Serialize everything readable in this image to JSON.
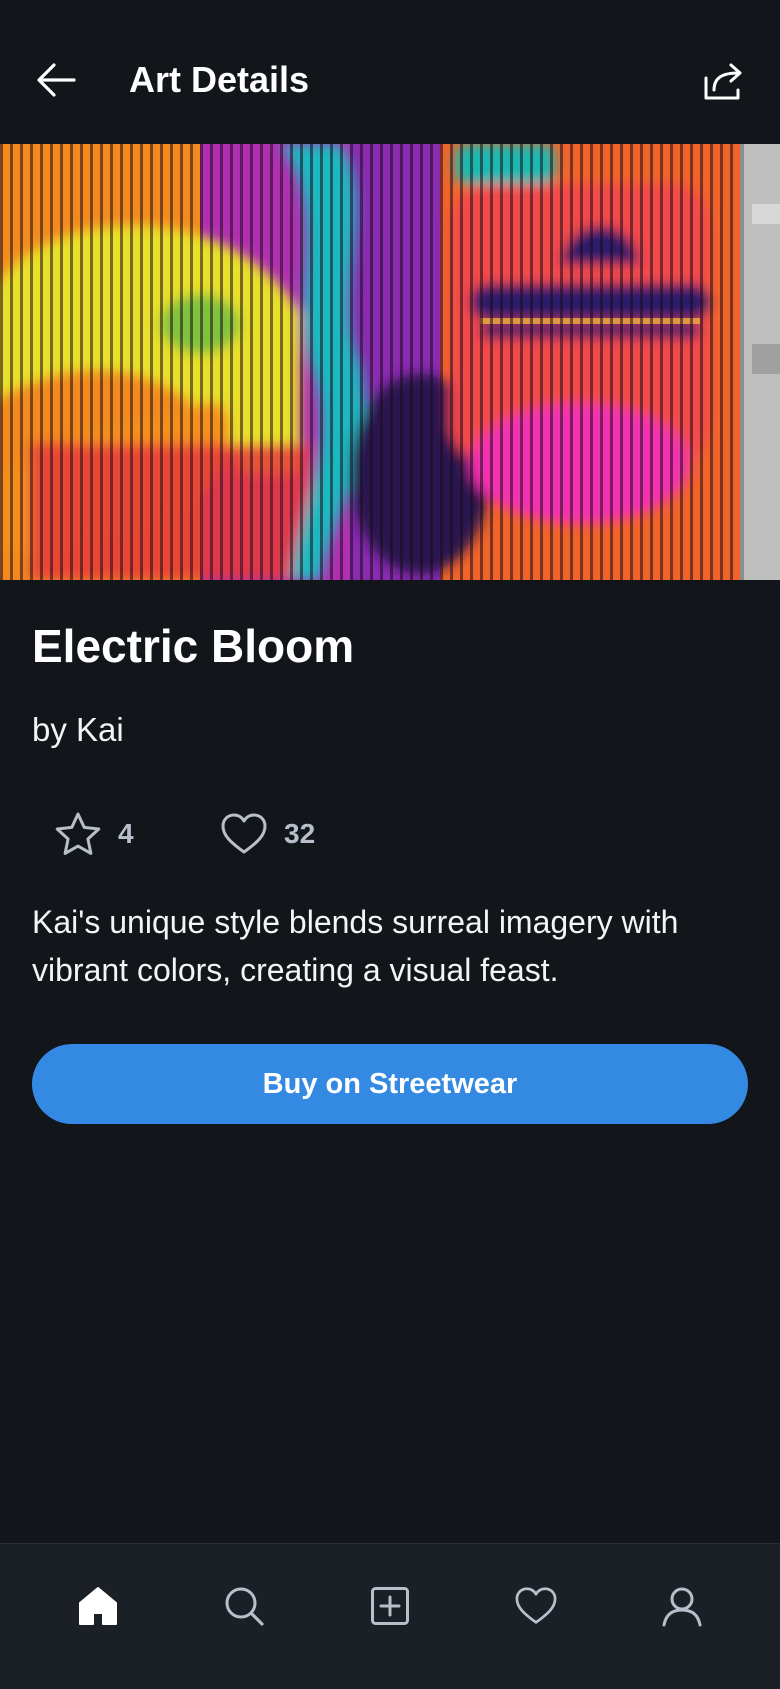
{
  "header": {
    "title": "Art Details",
    "back_icon": "arrow-left-icon",
    "share_icon": "share-icon"
  },
  "artwork": {
    "title": "Electric Bloom",
    "artist_line": "by Kai",
    "rating": "4",
    "likes": "32",
    "description": "Kai's unique style blends surreal imagery with vibrant colors, creating a visual feast."
  },
  "actions": {
    "buy_label": "Buy on Streetwear"
  },
  "bottom_nav": {
    "items": [
      {
        "name": "home",
        "icon": "home-icon",
        "active": true
      },
      {
        "name": "search",
        "icon": "search-icon",
        "active": false
      },
      {
        "name": "create",
        "icon": "plus-square-icon",
        "active": false
      },
      {
        "name": "favorites",
        "icon": "heart-icon",
        "active": false
      },
      {
        "name": "profile",
        "icon": "user-icon",
        "active": false
      }
    ]
  },
  "colors": {
    "background": "#121519",
    "accent": "#348ae3",
    "nav_background": "#1b1f26",
    "muted_text": "#b7bfca"
  }
}
